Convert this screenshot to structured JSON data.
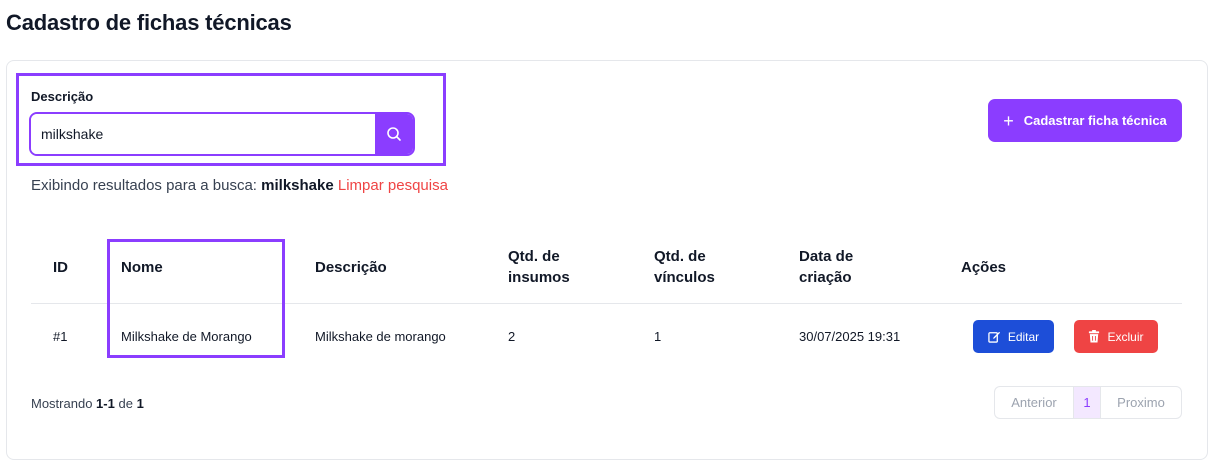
{
  "page": {
    "title": "Cadastro de fichas técnicas"
  },
  "search": {
    "label": "Descrição",
    "value": "milkshake",
    "button_icon": "search-icon"
  },
  "results": {
    "prefix": "Exibindo resultados para a busca:",
    "term": "milkshake",
    "clear_label": "Limpar pesquisa"
  },
  "add_button": {
    "icon": "plus-icon",
    "label": "Cadastrar ficha técnica"
  },
  "table": {
    "headers": {
      "id": "ID",
      "nome": "Nome",
      "descricao": "Descrição",
      "qtd_insumos": [
        "Qtd. de",
        "insumos"
      ],
      "qtd_vinculos": [
        "Qtd. de",
        "vínculos"
      ],
      "data_criacao": [
        "Data de",
        "criação"
      ],
      "acoes": "Ações"
    },
    "rows": [
      {
        "id": "#1",
        "nome": "Milkshake de Morango",
        "descricao": "Milkshake de morango",
        "qtd_insumos": "2",
        "qtd_vinculos": "1",
        "data_criacao": "30/07/2025 19:31",
        "edit_label": "Editar",
        "delete_label": "Excluir"
      }
    ]
  },
  "footer": {
    "showing_prefix": "Mostrando",
    "range": "1-1",
    "of": "de",
    "total": "1"
  },
  "pagination": {
    "prev": "Anterior",
    "current": "1",
    "next": "Proximo"
  },
  "colors": {
    "accent": "#8b3dff",
    "edit": "#1d4ed8",
    "delete": "#ef4444",
    "clear_link": "#ef4444"
  }
}
